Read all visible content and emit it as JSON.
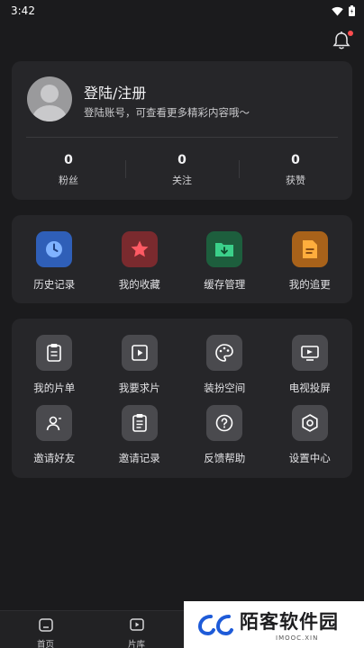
{
  "status_bar": {
    "time": "3:42"
  },
  "profile": {
    "login_title": "登陆/注册",
    "login_subtitle": "登陆账号，可查看更多精彩内容哦～",
    "stats": [
      {
        "value": "0",
        "label": "粉丝"
      },
      {
        "value": "0",
        "label": "关注"
      },
      {
        "value": "0",
        "label": "获赞"
      }
    ]
  },
  "quick_actions": [
    {
      "label": "历史记录",
      "icon": "clock-icon",
      "color": "#2f5fb8"
    },
    {
      "label": "我的收藏",
      "icon": "star-icon",
      "color": "#b8323a"
    },
    {
      "label": "缓存管理",
      "icon": "download-folder-icon",
      "color": "#1f9a5c"
    },
    {
      "label": "我的追更",
      "icon": "document-icon",
      "color": "#e59324"
    }
  ],
  "tools": [
    {
      "label": "我的片单",
      "icon": "clipboard-icon"
    },
    {
      "label": "我要求片",
      "icon": "play-square-icon"
    },
    {
      "label": "装扮空间",
      "icon": "palette-icon"
    },
    {
      "label": "电视投屏",
      "icon": "tv-icon"
    },
    {
      "label": "邀请好友",
      "icon": "invite-user-icon"
    },
    {
      "label": "邀请记录",
      "icon": "list-doc-icon"
    },
    {
      "label": "反馈帮助",
      "icon": "help-circle-icon"
    },
    {
      "label": "设置中心",
      "icon": "settings-hex-icon"
    }
  ],
  "bottom_nav": [
    {
      "label": "首页",
      "icon": "home-icon"
    },
    {
      "label": "片库",
      "icon": "video-library-icon"
    }
  ],
  "watermark": {
    "title": "陌客软件园",
    "subtitle": "IMOOC.XIN"
  }
}
